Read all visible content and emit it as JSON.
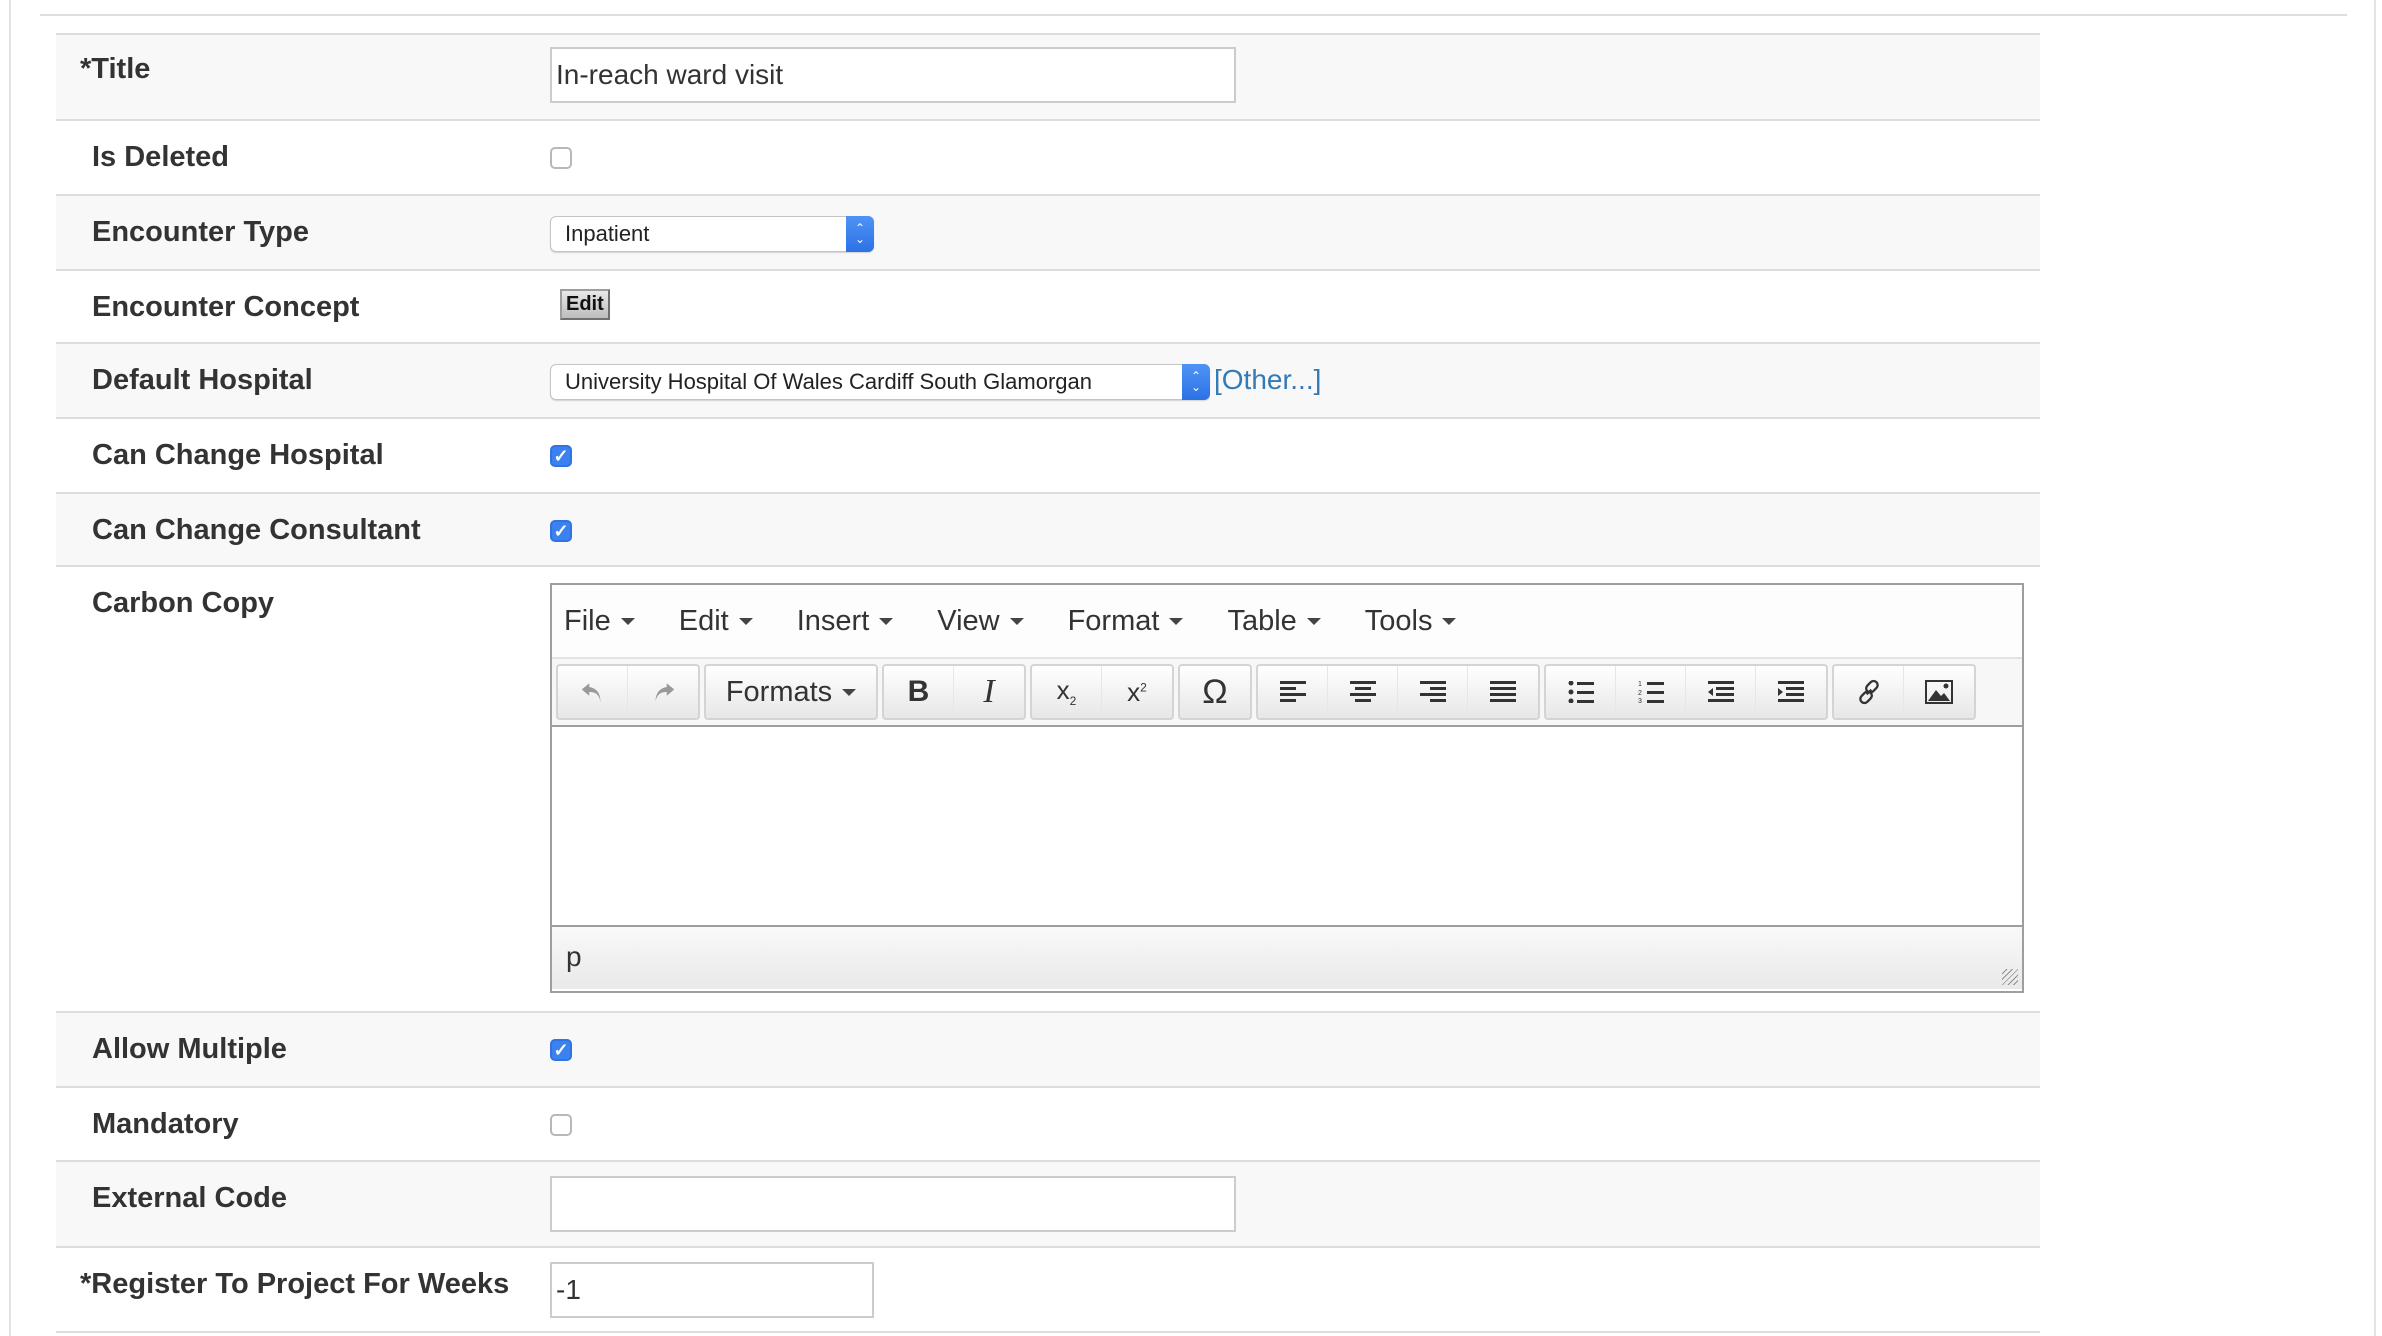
{
  "form": {
    "title": {
      "label": "*Title",
      "value": "In-reach ward visit"
    },
    "is_deleted": {
      "label": "Is Deleted",
      "checked": false
    },
    "encounter_type": {
      "label": "Encounter Type",
      "selected": "Inpatient"
    },
    "encounter_concept": {
      "label": "Encounter Concept",
      "button": "Edit"
    },
    "default_hospital": {
      "label": "Default Hospital",
      "selected": "University Hospital Of Wales Cardiff South Glamorgan",
      "other_link": "[Other...]"
    },
    "can_change_hospital": {
      "label": "Can Change Hospital",
      "checked": true
    },
    "can_change_consultant": {
      "label": "Can Change Consultant",
      "checked": true
    },
    "carbon_copy": {
      "label": "Carbon Copy",
      "editor": {
        "menus": [
          "File",
          "Edit",
          "Insert",
          "View",
          "Format",
          "Table",
          "Tools"
        ],
        "formats_label": "Formats",
        "toolbar_icons": [
          "undo-icon",
          "redo-icon",
          "formats-dropdown",
          "bold-icon",
          "italic-icon",
          "subscript-icon",
          "superscript-icon",
          "special-character-icon",
          "align-left-icon",
          "align-center-icon",
          "align-right-icon",
          "align-justify-icon",
          "bullet-list-icon",
          "numbered-list-icon",
          "outdent-icon",
          "indent-icon",
          "link-icon",
          "image-icon"
        ],
        "content": "",
        "status_path": "p"
      }
    },
    "allow_multiple": {
      "label": "Allow Multiple",
      "checked": true
    },
    "mandatory": {
      "label": "Mandatory",
      "checked": false
    },
    "external_code": {
      "label": "External Code",
      "value": ""
    },
    "register_weeks": {
      "label": "*Register To Project For Weeks",
      "value": "-1"
    }
  },
  "colors": {
    "link": "#337ab7",
    "checkbox_checked": "#3b82f0",
    "row_shade": "#f8f8f8"
  }
}
